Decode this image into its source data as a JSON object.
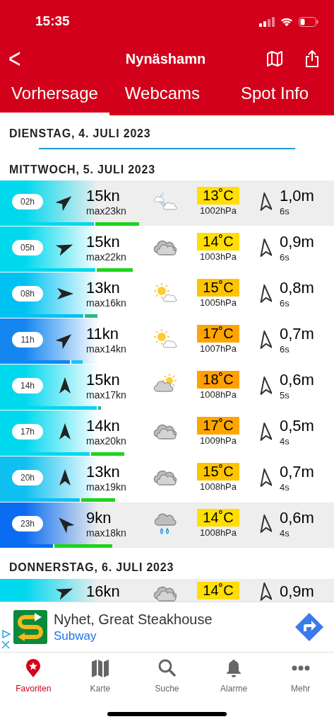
{
  "status_bar": {
    "time": "15:35"
  },
  "header": {
    "title": "Nynäshamn",
    "back": "<"
  },
  "tabs": [
    {
      "label": "Vorhersage",
      "selected": true
    },
    {
      "label": "Webcams",
      "selected": false
    },
    {
      "label": "Spot Info",
      "selected": false
    }
  ],
  "days": [
    {
      "date": "DIENSTAG, 4. JULI 2023"
    },
    {
      "date": "MITTWOCH, 5. JULI 2023",
      "rows": [
        {
          "hour": "02h",
          "highlighted": true,
          "wind_arrow": {
            "kind": "NE"
          },
          "speed": "15kn",
          "max": "max23kn",
          "weather": {
            "kind": "moon-cloud"
          },
          "temp": {
            "text": "13˚C",
            "color": "#ffde00"
          },
          "pressure": "1002hPa",
          "height": "1,0m",
          "period": "6s",
          "wind_bar": {
            "level": 0.285,
            "color": "#00d8ee"
          },
          "gust_bar": {
            "level": 0.417,
            "color": "#1ed41a"
          }
        },
        {
          "hour": "05h",
          "highlighted": false,
          "wind_arrow": {
            "kind": "ENE"
          },
          "speed": "15kn",
          "max": "max22kn",
          "weather": {
            "kind": "cloud"
          },
          "temp": {
            "text": "14˚C",
            "color": "#ffde00"
          },
          "pressure": "1003hPa",
          "height": "0,9m",
          "period": "6s",
          "wind_bar": {
            "level": 0.29,
            "color": "#00d8ee"
          },
          "gust_bar": {
            "level": 0.398,
            "color": "#1ed41a"
          }
        },
        {
          "hour": "08h",
          "highlighted": false,
          "wind_arrow": {
            "kind": "E"
          },
          "speed": "13kn",
          "max": "max16kn",
          "weather": {
            "kind": "sun-cloud"
          },
          "temp": {
            "text": "15˚C",
            "color": "#ffc400"
          },
          "pressure": "1005hPa",
          "height": "0,8m",
          "period": "6s",
          "wind_bar": {
            "level": 0.254,
            "color": "#00c2f2"
          },
          "gust_bar": {
            "level": 0.292,
            "color": "#2cb888"
          }
        },
        {
          "hour": "11h",
          "highlighted": false,
          "wind_arrow": {
            "kind": "NE"
          },
          "speed": "11kn",
          "max": "max14kn",
          "weather": {
            "kind": "sun-cloud"
          },
          "temp": {
            "text": "17˚C",
            "color": "#ffa500"
          },
          "pressure": "1007hPa",
          "height": "0,7m",
          "period": "6s",
          "wind_bar": {
            "level": 0.214,
            "color": "#1586f0"
          },
          "gust_bar": {
            "level": 0.247,
            "color": "#1cc4f2"
          }
        },
        {
          "hour": "14h",
          "highlighted": false,
          "wind_arrow": {
            "kind": "N"
          },
          "speed": "15kn",
          "max": "max17kn",
          "weather": {
            "kind": "cloud-sun"
          },
          "temp": {
            "text": "18˚C",
            "color": "#ffa000"
          },
          "pressure": "1008hPa",
          "height": "0,6m",
          "period": "5s",
          "wind_bar": {
            "level": 0.294,
            "color": "#00d8ee"
          },
          "gust_bar": {
            "level": 0.302,
            "color": "#2cb888"
          }
        },
        {
          "hour": "17h",
          "highlighted": false,
          "wind_arrow": {
            "kind": "N"
          },
          "speed": "14kn",
          "max": "max20kn",
          "weather": {
            "kind": "cloud"
          },
          "temp": {
            "text": "17˚C",
            "color": "#ffa500"
          },
          "pressure": "1009hPa",
          "height": "0,5m",
          "period": "4s",
          "wind_bar": {
            "level": 0.273,
            "color": "#00d8ee"
          },
          "gust_bar": {
            "level": 0.372,
            "color": "#1ed41a"
          }
        },
        {
          "hour": "20h",
          "highlighted": false,
          "wind_arrow": {
            "kind": "N"
          },
          "speed": "13kn",
          "max": "max19kn",
          "weather": {
            "kind": "cloud"
          },
          "temp": {
            "text": "15˚C",
            "color": "#ffc400"
          },
          "pressure": "1008hPa",
          "height": "0,7m",
          "period": "4s",
          "wind_bar": {
            "level": 0.243,
            "color": "#10c0f0"
          },
          "gust_bar": {
            "level": 0.345,
            "color": "#1ed41a"
          }
        },
        {
          "hour": "23h",
          "highlighted": true,
          "wind_arrow": {
            "kind": "NW"
          },
          "speed": "9kn",
          "max": "max18kn",
          "weather": {
            "kind": "rain"
          },
          "temp": {
            "text": "14˚C",
            "color": "#ffde00"
          },
          "pressure": "1008hPa",
          "height": "0,6m",
          "period": "4s",
          "wind_bar": {
            "level": 0.163,
            "color": "#0a6cf0"
          },
          "gust_bar": {
            "level": 0.336,
            "color": "#1ed41a"
          }
        }
      ]
    },
    {
      "date": "DONNERSTAG, 6. JULI 2023",
      "rows": [
        {
          "highlighted": true,
          "wind_arrow": {
            "kind": "ENE"
          },
          "speed": "16kn",
          "weather": {
            "kind": "cloud"
          },
          "temp": {
            "text": "14˚C",
            "color": "#ffde00"
          },
          "height": "0,9m"
        }
      ]
    }
  ],
  "ad": {
    "title": "Nyhet, Great Steakhouse",
    "advertiser": "Subway"
  },
  "nav": [
    {
      "label": "Favoriten",
      "selected": true,
      "kind": "star-pin"
    },
    {
      "label": "Karte",
      "selected": false,
      "kind": "map"
    },
    {
      "label": "Suche",
      "selected": false,
      "kind": "search"
    },
    {
      "label": "Alarme",
      "selected": false,
      "kind": "bell"
    },
    {
      "label": "Mehr",
      "selected": false,
      "kind": "more"
    }
  ]
}
